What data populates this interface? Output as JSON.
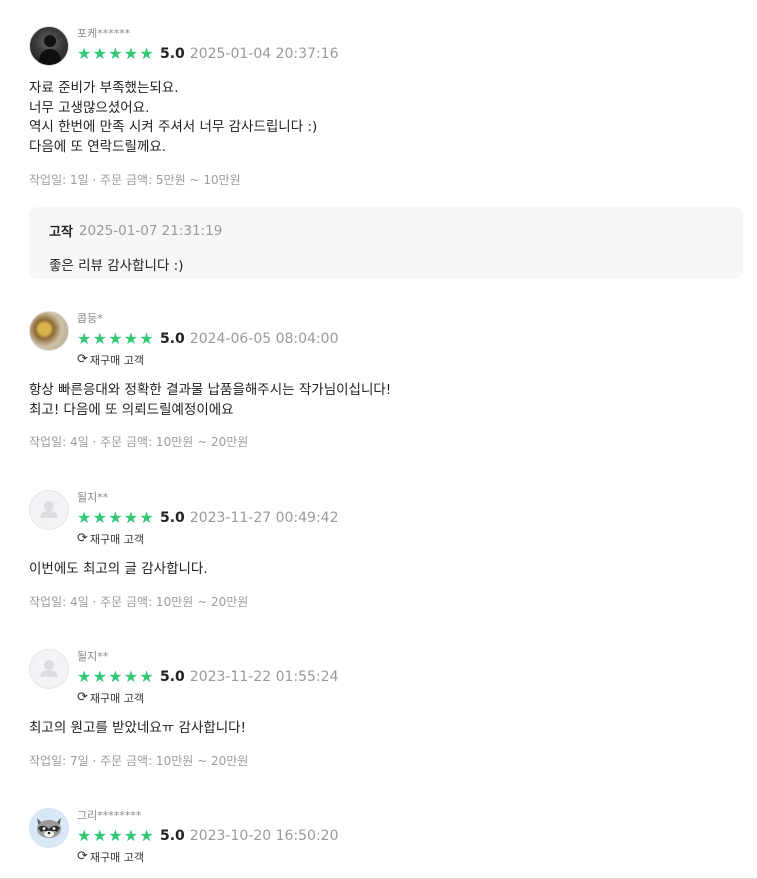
{
  "colors": {
    "star": "#35c776",
    "muted": "#9a9a9a",
    "reply_bg": "#f7f7f9"
  },
  "reviews": [
    {
      "nickname": "포케******",
      "avatar": "photo-person-icon",
      "rating": "5.0",
      "stars": 5,
      "datetime": "2025-01-04 20:37:16",
      "repurchase": null,
      "lines": [
        "자료 준비가 부족했는되요.",
        "너무 고생많으셨어요.",
        "역시 한번에 만족 시켜 주셔서 너무 감사드립니다 :)",
        "다음에 또 연락드릴께요."
      ],
      "info": "작업일: 1일 · 주문 금액: 5만원 ~ 10만원",
      "reply": {
        "author": "고작",
        "datetime": "2025-01-07 21:31:19",
        "text": "좋은 리뷰 감사합니다 :)"
      }
    },
    {
      "nickname": "콥등*",
      "avatar": "photo-food-icon",
      "rating": "5.0",
      "stars": 5,
      "datetime": "2024-06-05 08:04:00",
      "repurchase": "재구매 고객",
      "lines": [
        "항상 빠른응대와 정확한 결과물 납품을해주시는 작가님이십니다!",
        "최고! 다음에 또 의뢰드릴예정이에요"
      ],
      "info": "작업일: 4일 · 주문 금액: 10만원 ~ 20만원"
    },
    {
      "nickname": "될지**",
      "avatar": "default-user-icon",
      "rating": "5.0",
      "stars": 5,
      "datetime": "2023-11-27 00:49:42",
      "repurchase": "재구매 고객",
      "lines": [
        "이번에도 최고의 글 감사합니다."
      ],
      "info": "작업일: 4일 · 주문 금액: 10만원 ~ 20만원"
    },
    {
      "nickname": "될지**",
      "avatar": "default-user-icon",
      "rating": "5.0",
      "stars": 5,
      "datetime": "2023-11-22 01:55:24",
      "repurchase": "재구매 고객",
      "lines": [
        "최고의 원고를 받았네요ㅠ 감사합니다!"
      ],
      "info": "작업일: 7일 · 주문 금액: 10만원 ~ 20만원"
    },
    {
      "nickname": "그리********",
      "avatar": "raccoon-icon",
      "rating": "5.0",
      "stars": 5,
      "datetime": "2023-10-20 16:50:20",
      "repurchase": "재구매 고객"
    }
  ]
}
